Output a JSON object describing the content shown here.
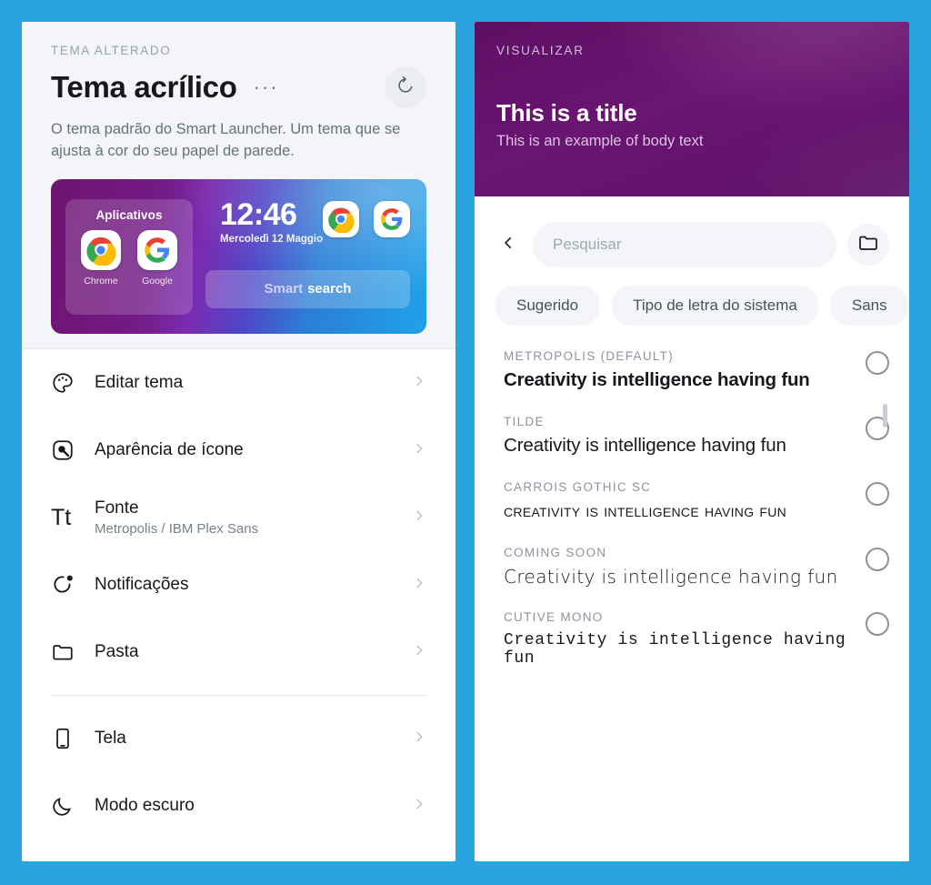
{
  "app": {
    "background_color": "#29a4e0",
    "accent_purple": "#6b1572"
  },
  "left_panel": {
    "eyebrow": "TEMA ALTERADO",
    "title": "Tema acrílico",
    "more_button": "···",
    "reset_icon": "reset-icon",
    "description": "O tema padrão do Smart Launcher. Um tema que se ajusta à cor do seu papel de parede.",
    "preview": {
      "apps_widget_title": "Aplicativos",
      "apps": [
        {
          "label": "Chrome",
          "icon": "chrome-icon"
        },
        {
          "label": "Google",
          "icon": "google-icon"
        }
      ],
      "clock_time": "12:46",
      "clock_date": "Mercoledì 12 Maggio",
      "dock_icons": [
        {
          "icon": "chrome-icon"
        },
        {
          "icon": "google-icon"
        }
      ],
      "search_label_accent": "Smart",
      "search_label_rest": "search"
    },
    "settings": [
      {
        "icon": "palette-icon",
        "label": "Editar tema",
        "sub": ""
      },
      {
        "icon": "icon-appearance-icon",
        "label": "Aparência de ícone",
        "sub": ""
      },
      {
        "icon": "font-tt-icon",
        "label": "Fonte",
        "sub": "Metropolis / IBM Plex Sans"
      },
      {
        "icon": "notification-bell-icon",
        "label": "Notificações",
        "sub": ""
      },
      {
        "icon": "folder-icon",
        "label": "Pasta",
        "sub": ""
      }
    ],
    "settings_group2": [
      {
        "icon": "phone-screen-icon",
        "label": "Tela",
        "sub": ""
      },
      {
        "icon": "moon-icon",
        "label": "Modo escuro",
        "sub": ""
      }
    ]
  },
  "right_panel": {
    "eyebrow": "VISUALIZAR",
    "preview_title": "This is a title",
    "preview_body": "This is an example of body text",
    "back_icon": "chevron-left-icon",
    "search_placeholder": "Pesquisar",
    "folder_icon": "folder-icon",
    "chips": [
      {
        "label": "Sugerido"
      },
      {
        "label": "Tipo de letra do sistema"
      },
      {
        "label": "Sans"
      }
    ],
    "fonts": [
      {
        "name": "METROPOLIS (DEFAULT)",
        "sample": "Creativity is intelligence having fun",
        "selected": false,
        "style": "s-metropolis"
      },
      {
        "name": "TILDE",
        "sample": "Creativity is intelligence having fun",
        "selected": false,
        "style": "s-tilde"
      },
      {
        "name": "CARROIS GOTHIC SC",
        "sample": "Creativity is intelligence having fun",
        "selected": false,
        "style": "s-carrois"
      },
      {
        "name": "COMING SOON",
        "sample": "Creativity is intelligence having fun",
        "selected": false,
        "style": "s-coming"
      },
      {
        "name": "CUTIVE MONO",
        "sample": "Creativity is intelligence having fun",
        "selected": false,
        "style": "s-cutive"
      }
    ]
  }
}
